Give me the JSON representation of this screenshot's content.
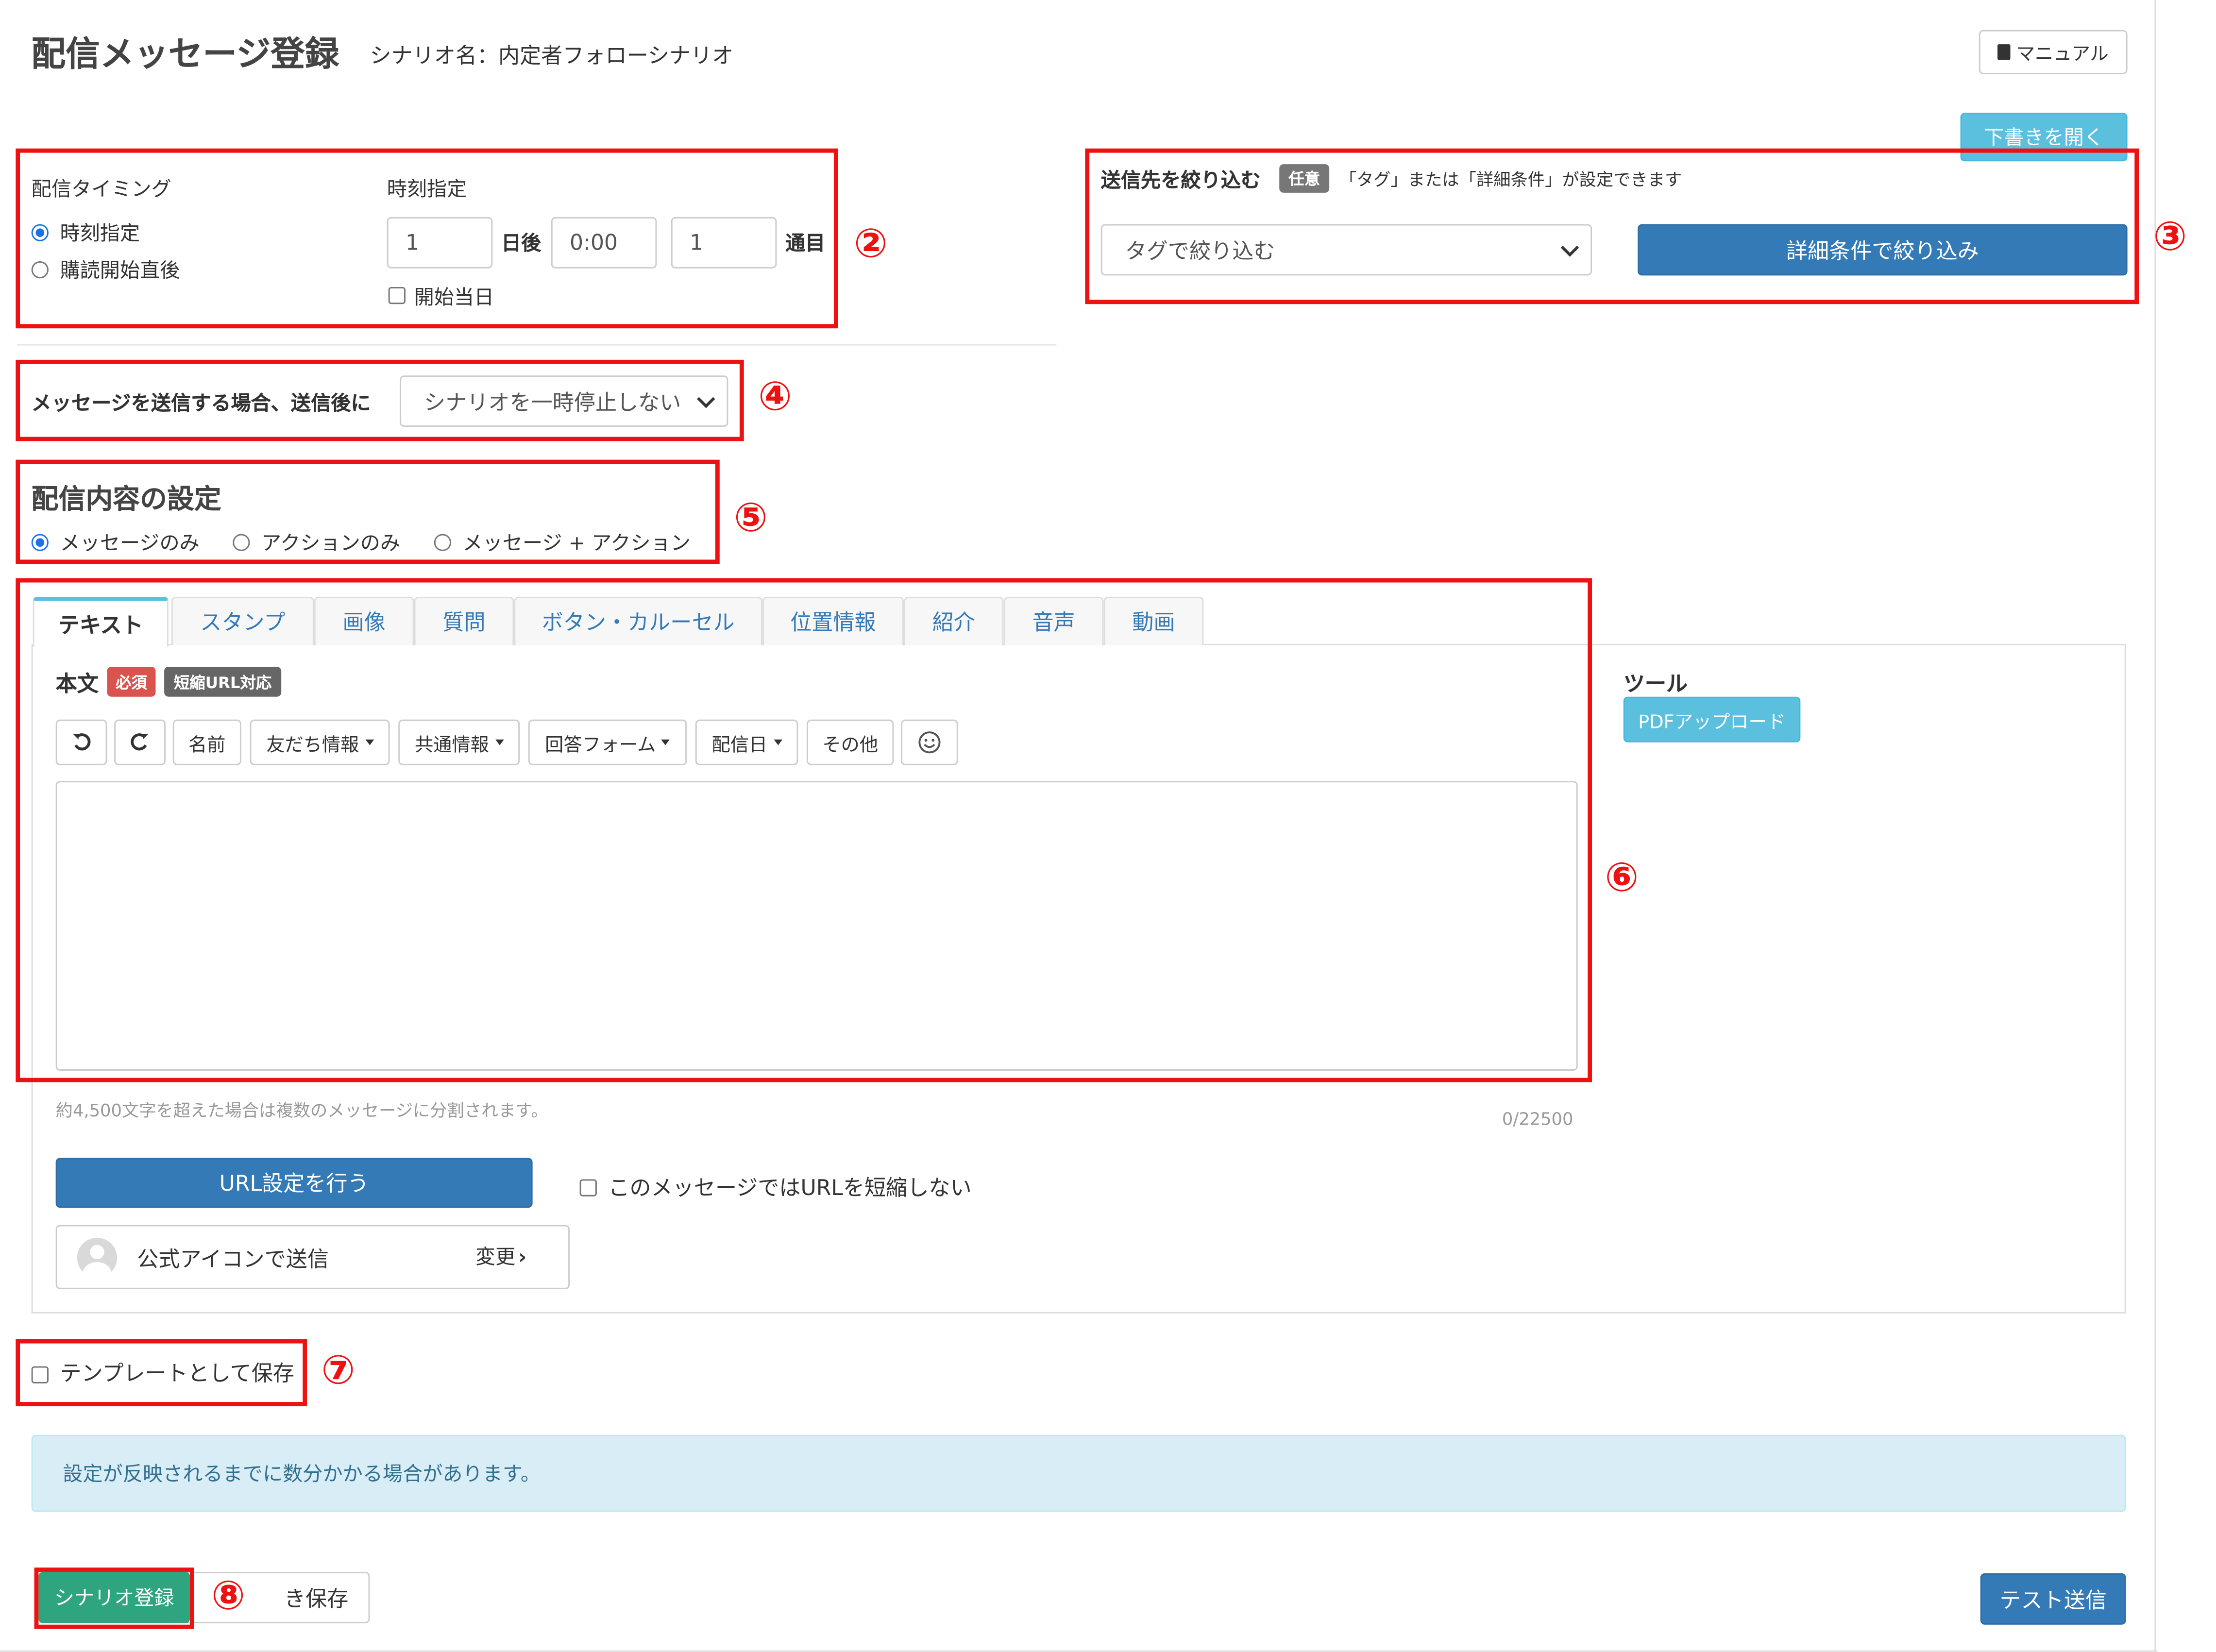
{
  "header": {
    "title": "配信メッセージ登録",
    "scenario_label": "シナリオ名：内定者フォローシナリオ",
    "manual_button": "マニュアル",
    "open_draft_button": "下書きを開く"
  },
  "timing": {
    "section_label": "配信タイミング",
    "options": [
      "時刻指定",
      "購読開始直後"
    ],
    "selected": "時刻指定",
    "time_label": "時刻指定",
    "days_value": "1",
    "days_suffix": "日後",
    "time_value": "0:00",
    "count_value": "1",
    "count_suffix": "通目",
    "start_day_checkbox": "開始当日"
  },
  "filter": {
    "label": "送信先を絞り込む",
    "optional_badge": "任意",
    "hint": "「タグ」または「詳細条件」が設定できます",
    "tag_select": "タグで絞り込む",
    "detail_button": "詳細条件で絞り込み"
  },
  "after_send": {
    "label": "メッセージを送信する場合、送信後に",
    "select_value": "シナリオを一時停止しない"
  },
  "content": {
    "heading": "配信内容の設定",
    "options": [
      "メッセージのみ",
      "アクションのみ",
      "メッセージ + アクション"
    ],
    "selected": "メッセージのみ"
  },
  "tabs": [
    "テキスト",
    "スタンプ",
    "画像",
    "質問",
    "ボタン・カルーセル",
    "位置情報",
    "紹介",
    "音声",
    "動画"
  ],
  "editor": {
    "body_label": "本文",
    "required_badge": "必須",
    "short_url_badge": "短縮URL対応",
    "toolbar": {
      "name": "名前",
      "friend_info": "友だち情報",
      "common_info": "共通情報",
      "answer_form": "回答フォーム",
      "delivery_date": "配信日",
      "other": "その他"
    },
    "textarea_value": "",
    "note": "約4,500文字を超えた場合は複数のメッセージに分割されます。",
    "counter": "0/22500",
    "url_button": "URL設定を行う",
    "no_shorten_checkbox": "このメッセージではURLを短縮しない",
    "sender_label": "公式アイコンで送信",
    "change_link": "変更"
  },
  "tools": {
    "label": "ツール",
    "pdf_button": "PDFアップロード"
  },
  "template_checkbox": "テンプレートとして保存",
  "notice": "設定が反映されるまでに数分かかる場合があります。",
  "footer": {
    "register_button": "シナリオ登録",
    "draft_button": "き保存",
    "test_button": "テスト送信"
  },
  "callouts": [
    "②",
    "③",
    "④",
    "⑤",
    "⑥",
    "⑦",
    "⑧"
  ],
  "colors": {
    "accent_red": "#ee1111",
    "primary_blue": "#337ab7",
    "info_blue": "#5bc0de",
    "success_green": "#2ea47f",
    "notice_bg": "#d9edf7"
  }
}
